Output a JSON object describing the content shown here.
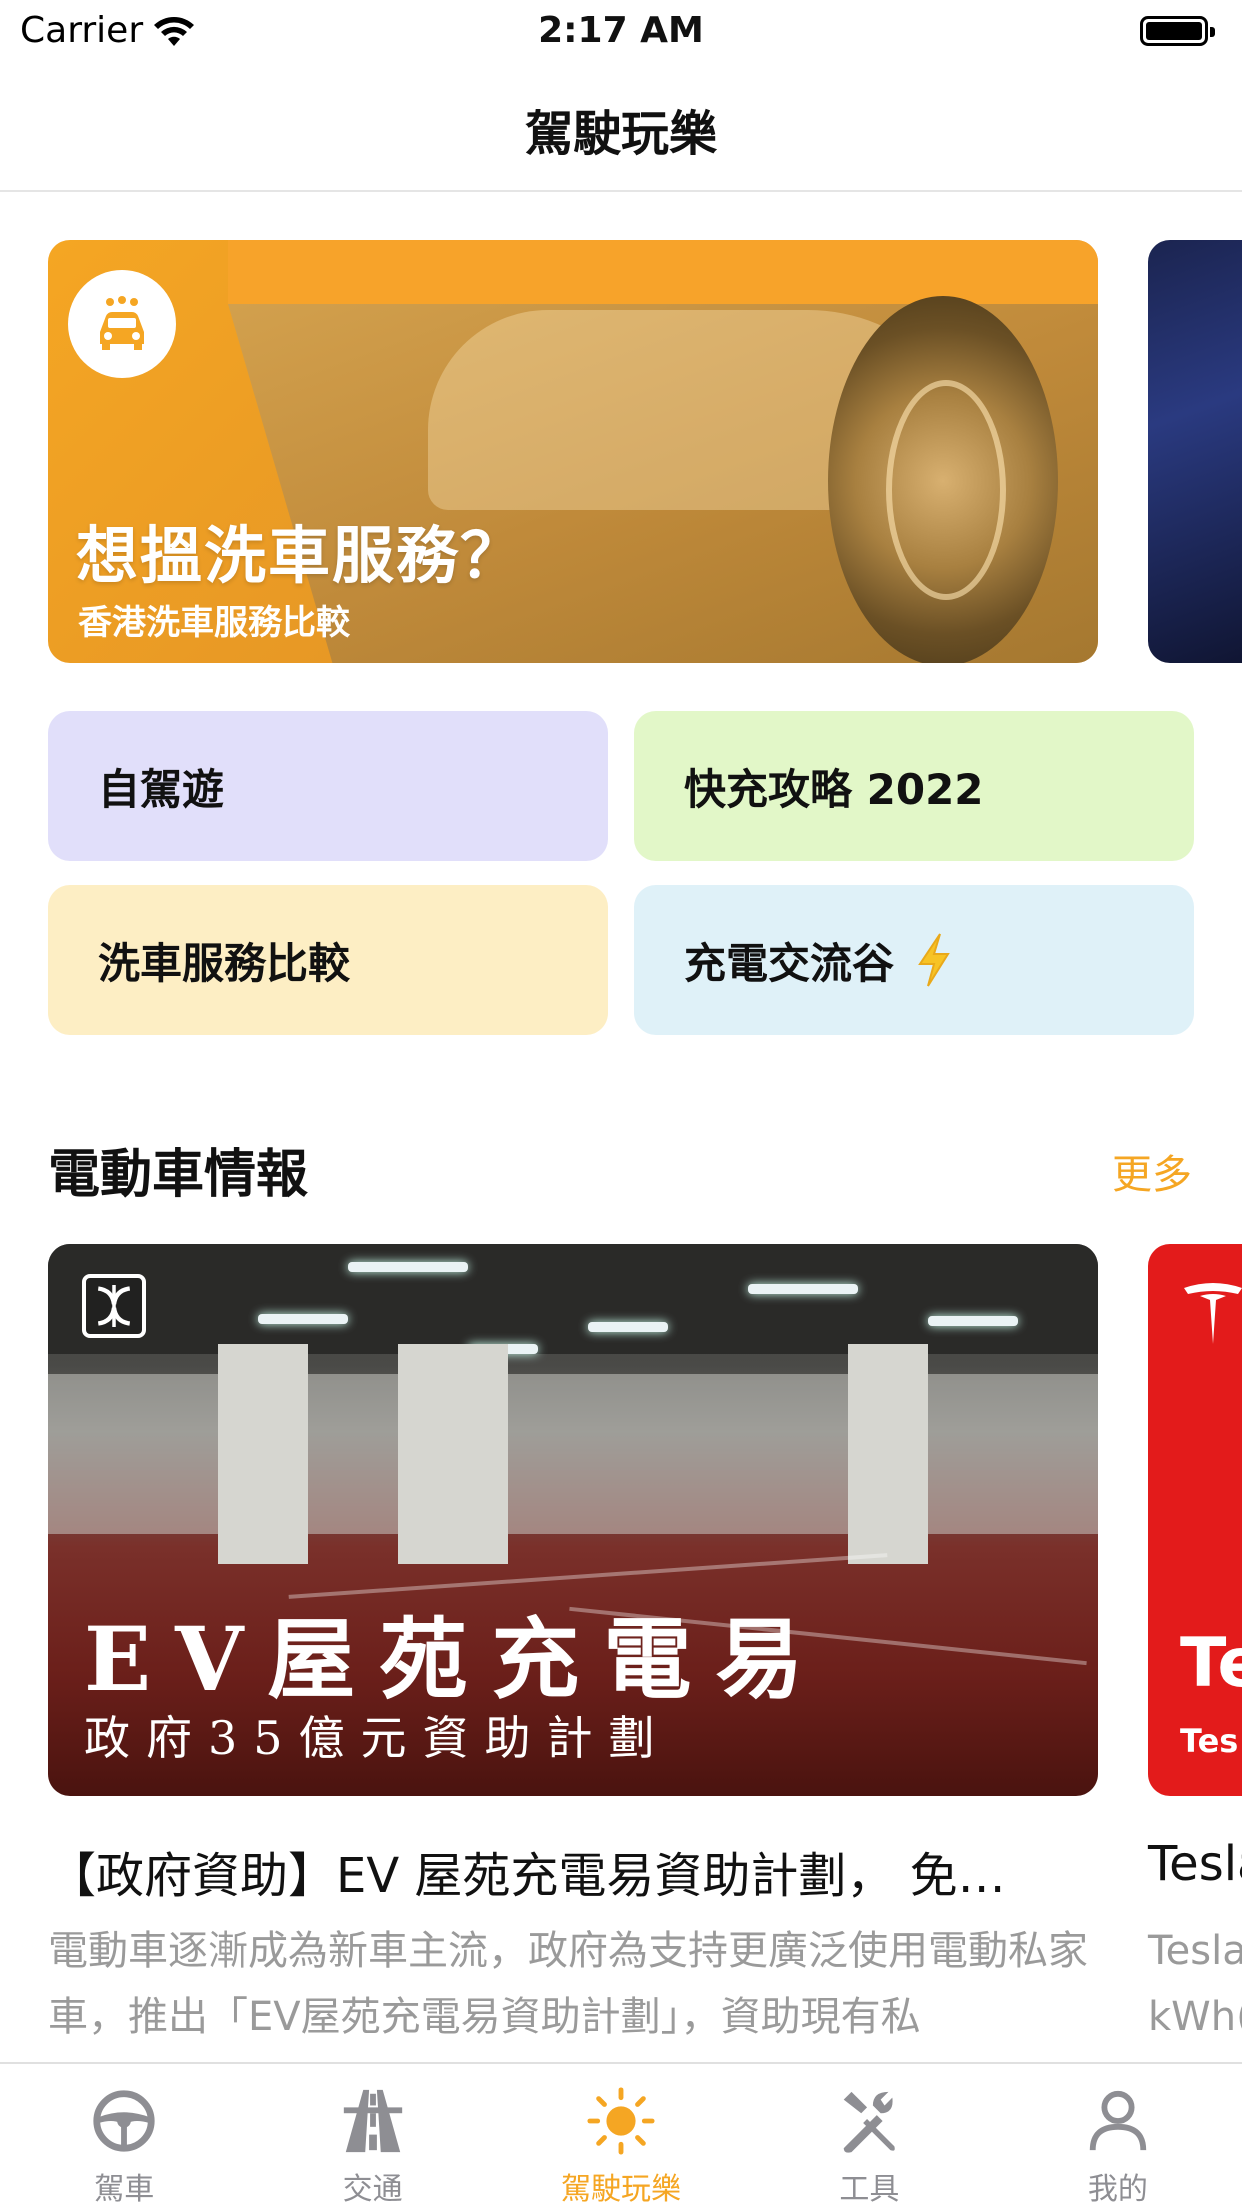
{
  "status_bar": {
    "carrier": "Carrier",
    "time": "2:17 AM"
  },
  "nav": {
    "title": "駕駛玩樂"
  },
  "banner": {
    "headline": "想搵洗車服務？",
    "subline": "香港洗車服務比較"
  },
  "quick_links": [
    {
      "label": "自駕遊",
      "color": "#e1dffa"
    },
    {
      "label": "快充攻略 2022",
      "color": "#e2f7c8"
    },
    {
      "label": "洗車服務比較",
      "color": "#fdeec4"
    },
    {
      "label": "充電交流谷",
      "color": "#dff1f8"
    }
  ],
  "section": {
    "title": "電動車情報",
    "more_label": "更多"
  },
  "news_cards": [
    {
      "image_headline": "EV屋苑充電易",
      "image_subline": "政府35億元資助計劃",
      "title": "【政府資助】EV 屋苑充電易資助計劃， 免…",
      "excerpt": "電動車逐漸成為新車主流，政府為支持更廣泛使用電動私家車，推出「EV屋苑充電易資助計劃」，資助現有私"
    },
    {
      "image_headline": "Te",
      "image_subline": "Tes",
      "title": "Tesla",
      "excerpt_line1": "Tesla",
      "excerpt_line2": "kWh("
    }
  ],
  "tab_bar": {
    "tabs": [
      {
        "label": "駕車",
        "icon": "steering-wheel-icon",
        "active": false
      },
      {
        "label": "交通",
        "icon": "road-icon",
        "active": false
      },
      {
        "label": "駕駛玩樂",
        "icon": "sun-icon",
        "active": true
      },
      {
        "label": "工具",
        "icon": "tools-icon",
        "active": false
      },
      {
        "label": "我的",
        "icon": "person-icon",
        "active": false
      }
    ]
  },
  "colors": {
    "accent": "#f5a623",
    "inactive_tab": "#8e8e93",
    "body_text": "#9a9a9a"
  }
}
